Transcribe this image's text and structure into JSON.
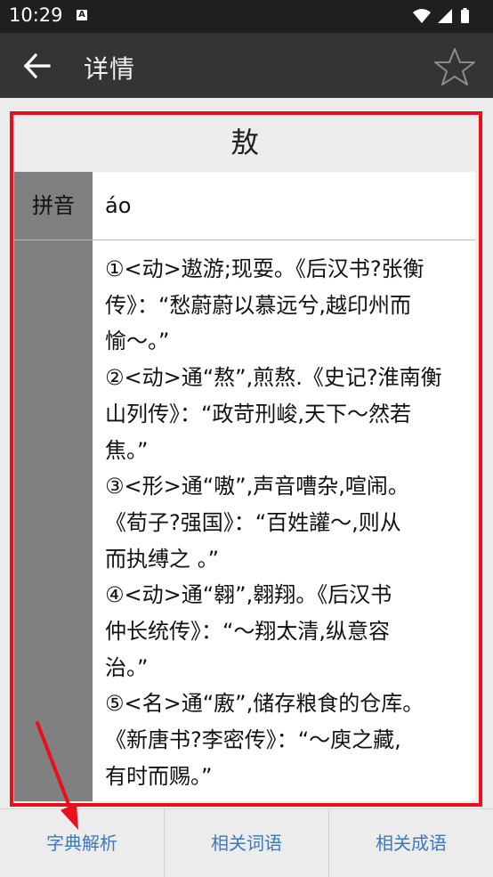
{
  "status_bar": {
    "time": "10:29",
    "notification_icon": "A",
    "icons": [
      "wifi-icon",
      "signal-icon",
      "battery-icon"
    ]
  },
  "app_bar": {
    "title": "详情",
    "back_icon": "arrow-left-icon",
    "favorite_icon": "star-outline-icon"
  },
  "entry": {
    "character": "敖",
    "pinyin_label": "拼音",
    "pinyin_value": "áo",
    "definition_lines": [
      "①<动>遨游;现耍。《后汉书?张衡",
      "传》：“愁蔚蔚以慕远兮,越印州而",
      "愉～。”",
      "②<动>通“熬”,煎熬.《史记?淮南衡",
      "山列传》：“政苛刑峻,天下～然若",
      "焦。”",
      "③<形>通“嗷”,声音嘈杂,喧闹。",
      "《荀子?强国》：“百姓讙～,则从",
      "而执缚之 。”",
      "④<动>通“翱”,翱翔。《后汉书",
      "仲长统传》：“～翔太清,纵意容",
      "治。”",
      "⑤<名>通“廒”,储存粮食的仓库。",
      "《新唐书?李密传》：“～庾之藏,",
      "有时而赐。”"
    ]
  },
  "bottom_tabs": {
    "tab1": "字典解析",
    "tab2": "相关词语",
    "tab3": "相关成语"
  },
  "colors": {
    "accent_tab_text": "#3d79b9",
    "highlight_red": "#e8101a",
    "app_bar_bg": "#333436"
  }
}
